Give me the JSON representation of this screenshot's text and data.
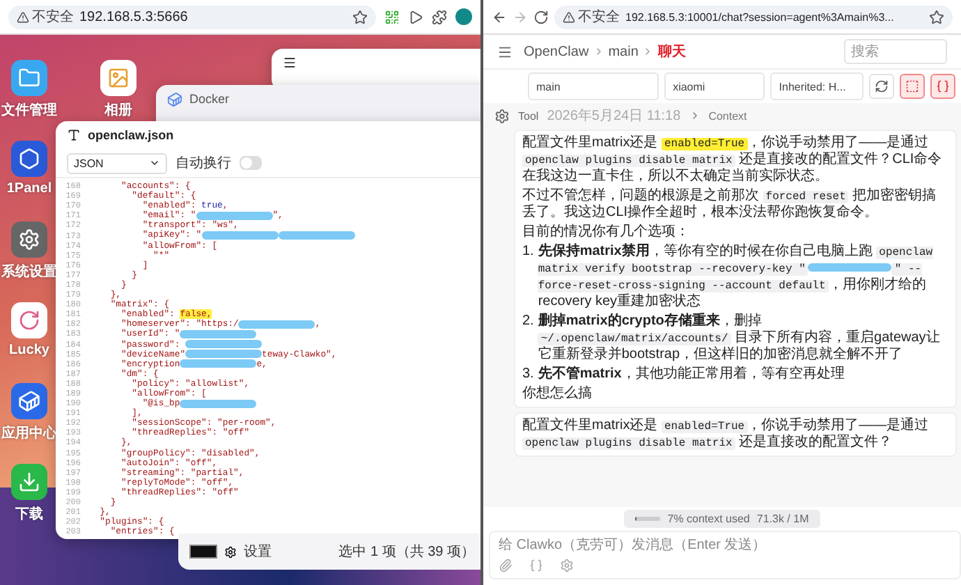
{
  "left_browser": {
    "security_label": "不安全",
    "url": "192.168.5.3:5666"
  },
  "desktop": {
    "icons": [
      {
        "label": "文件管理",
        "kind": "folder"
      },
      {
        "label": "1Panel",
        "kind": "panel"
      },
      {
        "label": "系统设置",
        "kind": "settings"
      },
      {
        "label": "Lucky",
        "kind": "lucky"
      },
      {
        "label": "应用中心",
        "kind": "store"
      },
      {
        "label": "下载",
        "kind": "download"
      }
    ],
    "photos_icon": {
      "label": "相册"
    }
  },
  "docker_window": {
    "title": "Docker"
  },
  "editor": {
    "title": "openclaw.json",
    "language": "JSON",
    "wrap_label": "自动换行",
    "wrap_on": false,
    "lines": [
      {
        "number": "168",
        "parts": [
          {
            "kind": "code",
            "text": "      \"accounts\": {"
          }
        ]
      },
      {
        "number": "169",
        "parts": [
          {
            "kind": "code",
            "text": "        \"default\": {"
          }
        ]
      },
      {
        "number": "170",
        "parts": [
          {
            "kind": "code",
            "text": "          \"enabled\": "
          },
          {
            "kind": "keyword",
            "text": "true"
          },
          {
            "kind": "code",
            "text": ","
          }
        ]
      },
      {
        "number": "171",
        "parts": [
          {
            "kind": "code",
            "text": "          \"email\": \""
          },
          {
            "kind": "redacted"
          },
          {
            "kind": "code",
            "text": "\","
          }
        ]
      },
      {
        "number": "172",
        "parts": [
          {
            "kind": "code",
            "text": "          \"transport\": \"ws\","
          }
        ]
      },
      {
        "number": "173",
        "parts": [
          {
            "kind": "code",
            "text": "          \"apiKey\": \""
          },
          {
            "kind": "redacted"
          },
          {
            "kind": "redacted"
          }
        ]
      },
      {
        "number": "174",
        "parts": [
          {
            "kind": "code",
            "text": "          \"allowFrom\": ["
          }
        ]
      },
      {
        "number": "175",
        "parts": [
          {
            "kind": "code",
            "text": "            \"*\""
          }
        ]
      },
      {
        "number": "176",
        "parts": [
          {
            "kind": "code",
            "text": "          ]"
          }
        ]
      },
      {
        "number": "177",
        "parts": [
          {
            "kind": "code",
            "text": "        }"
          }
        ]
      },
      {
        "number": "178",
        "parts": [
          {
            "kind": "code",
            "text": "      }"
          }
        ]
      },
      {
        "number": "179",
        "parts": [
          {
            "kind": "code",
            "text": "    },"
          }
        ]
      },
      {
        "number": "180",
        "parts": [
          {
            "kind": "code",
            "text": "    \"matrix\": {"
          }
        ]
      },
      {
        "number": "181",
        "parts": [
          {
            "kind": "code",
            "text": "      \"enabled\": "
          },
          {
            "kind": "highlight",
            "text": "false,"
          }
        ]
      },
      {
        "number": "182",
        "parts": [
          {
            "kind": "code",
            "text": "      \"homeserver\": \"https:/"
          },
          {
            "kind": "redacted"
          },
          {
            "kind": "code",
            "text": ","
          }
        ]
      },
      {
        "number": "183",
        "parts": [
          {
            "kind": "code",
            "text": "      \"userId\": \""
          },
          {
            "kind": "redacted"
          }
        ]
      },
      {
        "number": "184",
        "parts": [
          {
            "kind": "code",
            "text": "      \"password\": "
          },
          {
            "kind": "redacted"
          }
        ]
      },
      {
        "number": "185",
        "parts": [
          {
            "kind": "code",
            "text": "      \"deviceName\""
          },
          {
            "kind": "redacted"
          },
          {
            "kind": "code",
            "text": "teway-Clawko\","
          }
        ]
      },
      {
        "number": "186",
        "parts": [
          {
            "kind": "code",
            "text": "      \"encryption"
          },
          {
            "kind": "redacted"
          },
          {
            "kind": "code",
            "text": "e,"
          }
        ]
      },
      {
        "number": "187",
        "parts": [
          {
            "kind": "code",
            "text": "      \"dm\": {"
          }
        ]
      },
      {
        "number": "188",
        "parts": [
          {
            "kind": "code",
            "text": "        \"policy\": \"allowlist\","
          }
        ]
      },
      {
        "number": "189",
        "parts": [
          {
            "kind": "code",
            "text": "        \"allowFrom\": ["
          }
        ]
      },
      {
        "number": "190",
        "parts": [
          {
            "kind": "code",
            "text": "          \"@is_bp"
          },
          {
            "kind": "redacted"
          }
        ]
      },
      {
        "number": "191",
        "parts": [
          {
            "kind": "code",
            "text": "        ],"
          }
        ]
      },
      {
        "number": "192",
        "parts": [
          {
            "kind": "code",
            "text": "        \"sessionScope\": \"per-room\","
          }
        ]
      },
      {
        "number": "193",
        "parts": [
          {
            "kind": "code",
            "text": "        \"threadReplies\": \"off\""
          }
        ]
      },
      {
        "number": "194",
        "parts": [
          {
            "kind": "code",
            "text": "      },"
          }
        ]
      },
      {
        "number": "195",
        "parts": [
          {
            "kind": "code",
            "text": "      \"groupPolicy\": \"disabled\","
          }
        ]
      },
      {
        "number": "196",
        "parts": [
          {
            "kind": "code",
            "text": "      \"autoJoin\": \"off\","
          }
        ]
      },
      {
        "number": "197",
        "parts": [
          {
            "kind": "code",
            "text": "      \"streaming\": \"partial\","
          }
        ]
      },
      {
        "number": "198",
        "parts": [
          {
            "kind": "code",
            "text": "      \"replyToMode\": \"off\","
          }
        ]
      },
      {
        "number": "199",
        "parts": [
          {
            "kind": "code",
            "text": "      \"threadReplies\": \"off\""
          }
        ]
      },
      {
        "number": "200",
        "parts": [
          {
            "kind": "code",
            "text": "    }"
          }
        ]
      },
      {
        "number": "201",
        "parts": [
          {
            "kind": "code",
            "text": "  },"
          }
        ]
      },
      {
        "number": "202",
        "parts": [
          {
            "kind": "code",
            "text": "  \"plugins\": {"
          }
        ]
      },
      {
        "number": "203",
        "parts": [
          {
            "kind": "code",
            "text": "    \"entries\": {"
          }
        ]
      }
    ]
  },
  "file_manager_bar": {
    "settings_label": "设置",
    "selection": "选中 1 项（共 39 项）"
  },
  "right_browser": {
    "security_label": "不安全",
    "url": "192.168.5.3:10001/chat?session=agent%3Amain%3..."
  },
  "header": {
    "breadcrumb": [
      {
        "label": "OpenClaw",
        "selected": false
      },
      {
        "label": "main",
        "selected": false
      },
      {
        "label": "聊天",
        "selected": true
      }
    ],
    "search": {
      "placeholder": "搜索"
    }
  },
  "session_controls": {
    "fields": [
      "main",
      "xiaomi",
      "Inherited: H..."
    ]
  },
  "message_meta": {
    "sender": "Tool",
    "time": "2026年5月24日 11:18",
    "context_link": "Context"
  },
  "messages": [
    {
      "blocks": [
        {
          "kind": "paragraph",
          "parts": [
            {
              "kind": "text",
              "text": "配置文件里matrix还是 "
            },
            {
              "kind": "code_marked",
              "text": "enabled=True"
            },
            {
              "kind": "text",
              "text": "，你说手动禁用了——是通过 "
            },
            {
              "kind": "code",
              "text": "openclaw plugins disable matrix"
            },
            {
              "kind": "text",
              "text": " 还是直接改的配置文件？CLI命令在我这边一直卡住，所以不太确定当前实际状态。"
            }
          ]
        },
        {
          "kind": "paragraph",
          "parts": [
            {
              "kind": "text",
              "text": "不过不管怎样，问题的根源是之前那次 "
            },
            {
              "kind": "code",
              "text": "forced reset"
            },
            {
              "kind": "text",
              "text": " 把加密密钥搞丢了。我这边CLI操作全超时，根本没法帮你跑恢复命令。"
            }
          ]
        },
        {
          "kind": "paragraph",
          "parts": [
            {
              "kind": "text",
              "text": "目前的情况你有几个选项："
            }
          ]
        },
        {
          "kind": "list",
          "items": [
            {
              "marker": "1.",
              "parts": [
                {
                  "kind": "text",
                  "text": "**先保持matrix禁用**，等你有空的时候在你自己电脑上跑 "
                },
                {
                  "kind": "code",
                  "text": "openclaw matrix verify bootstrap --recovery-key \""
                },
                {
                  "kind": "redacted"
                },
                {
                  "kind": "code",
                  "text": "\" --force-reset-cross-signing --account default"
                },
                {
                  "kind": "text",
                  "text": "，用你刚才给的recovery key重建加密状态"
                }
              ]
            },
            {
              "marker": "2.",
              "parts": [
                {
                  "kind": "text",
                  "text": "**删掉matrix的crypto存储重来**，删掉 "
                },
                {
                  "kind": "code",
                  "text": "~/.openclaw/matrix/accounts/"
                },
                {
                  "kind": "text",
                  "text": " 目录下所有内容，重启gateway让它重新登录并bootstrap，但这样旧的加密消息就全解不开了"
                }
              ]
            },
            {
              "marker": "3.",
              "parts": [
                {
                  "kind": "text",
                  "text": "**先不管matrix**，其他功能正常用着，等有空再处理"
                }
              ]
            }
          ]
        },
        {
          "kind": "paragraph",
          "parts": [
            {
              "kind": "text",
              "text": "你想怎么搞"
            }
          ]
        }
      ]
    },
    {
      "blocks": [
        {
          "kind": "paragraph",
          "parts": [
            {
              "kind": "text",
              "text": "配置文件里matrix还是 "
            },
            {
              "kind": "code",
              "text": "enabled=True"
            },
            {
              "kind": "text",
              "text": "，你说手动禁用了——是通过 "
            },
            {
              "kind": "code",
              "text": "openclaw plugins disable matrix"
            },
            {
              "kind": "text",
              "text": " 还是直接改的配置文件？"
            }
          ]
        }
      ]
    }
  ],
  "context_usage": {
    "level": 0.07,
    "label": "7% context used",
    "tokens": "71.3k / 1M"
  },
  "composer": {
    "placeholder": "给 Clawko（克劳可）发消息（Enter 发送）"
  }
}
